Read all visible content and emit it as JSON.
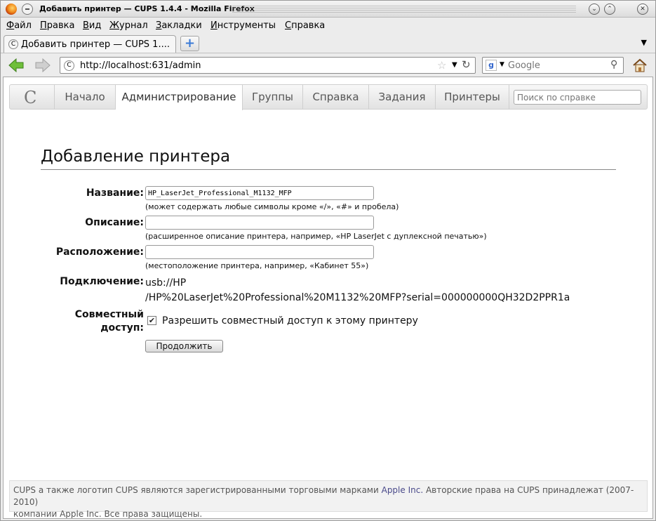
{
  "window": {
    "title": "Добавить принтер — CUPS 1.4.4 - Mozilla Firefox"
  },
  "menubar": {
    "items": [
      "Файл",
      "Правка",
      "Вид",
      "Журнал",
      "Закладки",
      "Инструменты",
      "Справка"
    ]
  },
  "tab": {
    "label": "Добавить принтер — CUPS 1...."
  },
  "navbar": {
    "url": "http://localhost:631/admin",
    "search_placeholder": "Google"
  },
  "cups_nav": {
    "tabs": [
      "Начало",
      "Администрирование",
      "Группы",
      "Справка",
      "Задания",
      "Принтеры"
    ],
    "active": "Администрирование",
    "help_search_placeholder": "Поиск по справке"
  },
  "form": {
    "title": "Добавление принтера",
    "name_label": "Название:",
    "name_value": "HP_LaserJet_Professional_M1132_MFP",
    "name_hint": "(может содержать любые символы кроме «/», «#» и пробела)",
    "description_label": "Описание:",
    "description_value": "",
    "description_hint": "(расширенное описание принтера, например, «HP LaserJet с дуплексной печатью»)",
    "location_label": "Расположение:",
    "location_value": "",
    "location_hint": "(местоположение принтера, например, «Кабинет 55»)",
    "connection_label": "Подключение:",
    "connection_line1": "usb://HP",
    "connection_line2": "/HP%20LaserJet%20Professional%20M1132%20MFP?serial=000000000QH32D2PPR1a",
    "sharing_label_line1": "Совместный",
    "sharing_label_line2": "доступ:",
    "sharing_checked": true,
    "sharing_text": "Разрешить совместный доступ к этому принтеру",
    "continue_label": "Продолжить"
  },
  "footer": {
    "text_before": "CUPS а также логотип CUPS являются зарегистрированными торговыми марками",
    "link": "Apple Inc.",
    "text_after": "Авторские права на CUPS принадлежат (2007-2010)",
    "line2": "компании Apple Inc. Все права защищены."
  }
}
